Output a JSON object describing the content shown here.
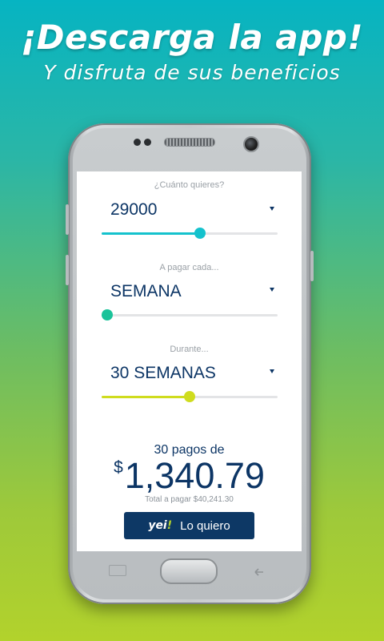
{
  "promo": {
    "title": "¡Descarga la app!",
    "subtitle": "Y disfruta de sus beneficios"
  },
  "form": {
    "amount": {
      "label": "¿Cuánto quieres?",
      "value": "29000",
      "slider_fraction": 0.56,
      "color": "#14c2cd"
    },
    "frequency": {
      "label": "A pagar cada...",
      "value": "SEMANA",
      "slider_fraction": 0.03,
      "color": "#1bc39a"
    },
    "duration": {
      "label": "Durante...",
      "value": "30 SEMANAS",
      "slider_fraction": 0.5,
      "color": "#cfdc1e"
    }
  },
  "summary": {
    "payments_text": "30 pagos de",
    "currency": "$",
    "payment_amount": "1,340.79",
    "total_text": "Total a pagar $40,241.30"
  },
  "cta": {
    "brand": "yei",
    "brand_accent": "!",
    "label": "Lo quiero"
  },
  "colors": {
    "primary": "#0c3565",
    "accent": "#b2d22c"
  }
}
